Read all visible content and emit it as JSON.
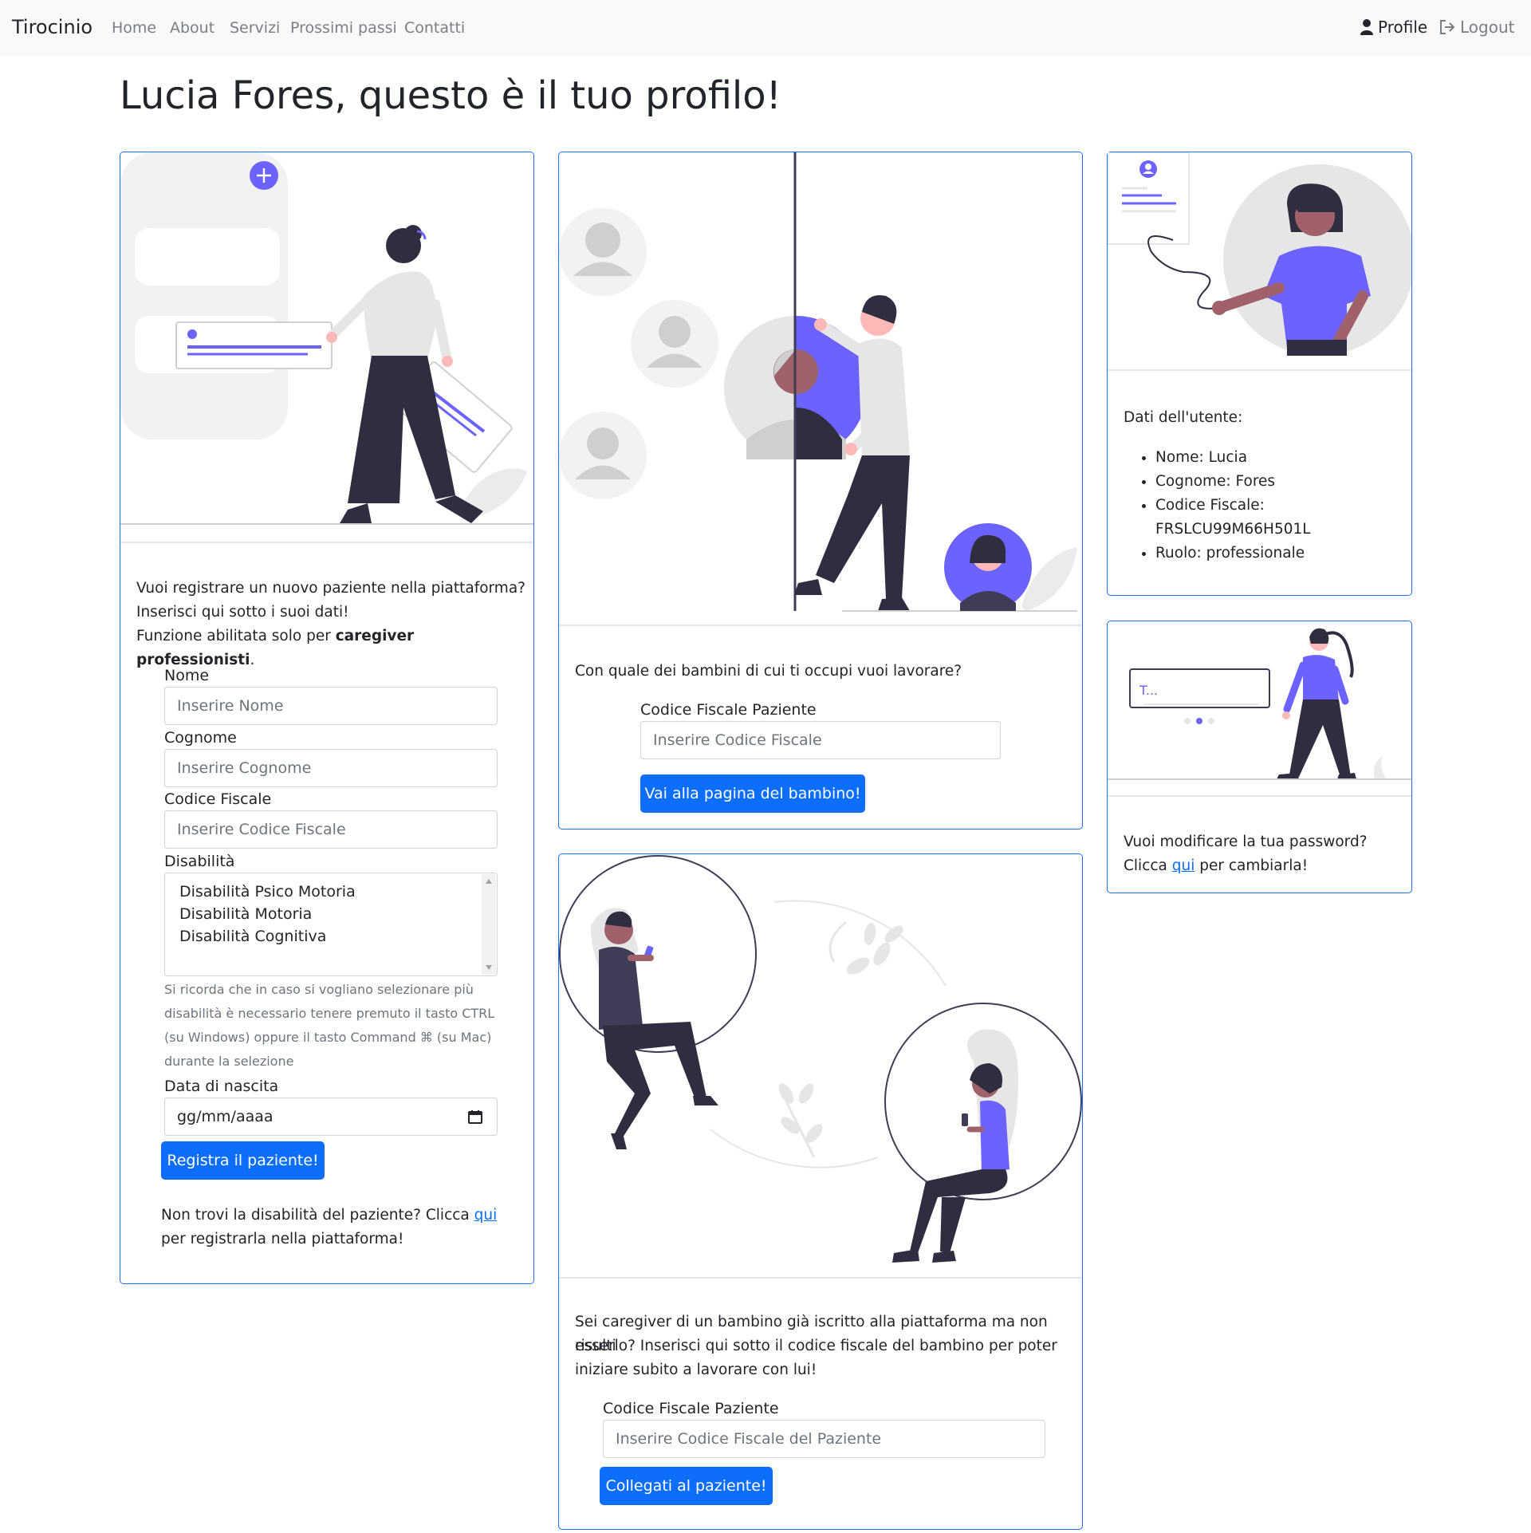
{
  "nav": {
    "brand": "Tirocinio",
    "links": [
      "Home",
      "About",
      "Servizi",
      "Prossimi passi",
      "Contatti"
    ],
    "profile": "Profile",
    "logout": "Logout"
  },
  "page_title": "Lucia Fores, questo è il tuo profilo!",
  "register_card": {
    "line1": "Vuoi registrare un nuovo paziente nella piattaforma?",
    "line2": "Inserisci qui sotto i suoi dati!",
    "line3_pre": "Funzione abilitata solo per ",
    "line3_bold": "caregiver professionisti",
    "line3_post": ".",
    "nome_label": "Nome",
    "nome_placeholder": "Inserire Nome",
    "cognome_label": "Cognome",
    "cognome_placeholder": "Inserire Cognome",
    "cf_label": "Codice Fiscale",
    "cf_placeholder": "Inserire Codice Fiscale",
    "disab_label": "Disabilità",
    "disab_options": [
      "Disabilità Psico Motoria",
      "Disabilità Motoria",
      "Disabilità Cognitiva"
    ],
    "hint_lines": [
      "Si ricorda che in caso si vogliano selezionare più",
      "disabilità è necessario tenere premuto il tasto CTRL",
      "(su Windows) oppure il tasto Command ⌘ (su Mac)",
      "durante la selezione"
    ],
    "dob_label": "Data di nascita",
    "dob_value": "gg/mm/aaaa",
    "submit": "Registra il paziente!",
    "footer_pre": "Non trovi la disabilità del paziente? Clicca ",
    "footer_link": "qui",
    "footer_post": "per registrarla nella piattaforma!"
  },
  "child_card": {
    "question": "Con quale dei bambini di cui ti occupi vuoi lavorare?",
    "cf_label": "Codice Fiscale Paziente",
    "cf_placeholder": "Inserire Codice Fiscale",
    "button": "Vai alla pagina del bambino!"
  },
  "connect_card": {
    "lines": [
      "Sei caregiver di un bambino già iscritto alla piattaforma ma non risulti",
      "esserlo? Inserisci qui sotto il codice fiscale del bambino per poter",
      "iniziare subito a lavorare con lui!"
    ],
    "cf_label": "Codice Fiscale Paziente",
    "cf_placeholder": "Inserire Codice Fiscale del Paziente",
    "button": "Collegati al paziente!"
  },
  "user_card": {
    "title": "Dati dell'utente:",
    "items": [
      "Nome: Lucia",
      "Cognome: Fores",
      "Codice Fiscale:",
      "FRSLCU99M66H501L",
      "Ruolo: professionale"
    ]
  },
  "password_card": {
    "line1": "Vuoi modificare la tua password?",
    "line2_pre": "Clicca ",
    "line2_link": "qui",
    "line2_post": " per cambiarla!",
    "illus_input": "T..."
  },
  "colors": {
    "accent": "#6c63ff",
    "primary": "#0d6efd",
    "dark": "#2f2e41",
    "border": "#1a6efc"
  }
}
